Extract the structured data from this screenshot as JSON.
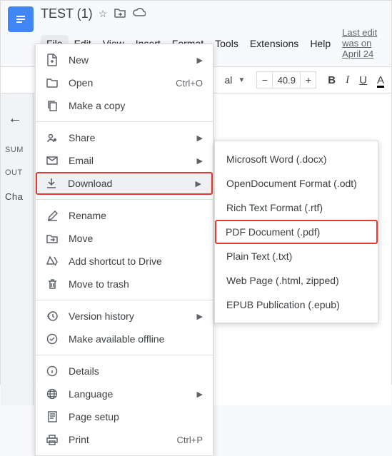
{
  "header": {
    "title": "TEST (1)",
    "edit_info": "Last edit was on April 24",
    "menu": [
      "File",
      "Edit",
      "View",
      "Insert",
      "Format",
      "Tools",
      "Extensions",
      "Help"
    ]
  },
  "toolbar": {
    "zoom": "40.9",
    "bold": "B",
    "italic": "I",
    "underline": "U",
    "text_color": "A"
  },
  "left_panel": {
    "summary": "SUM",
    "outline": "OUT",
    "chapter": "Cha"
  },
  "file_menu": {
    "new": "New",
    "open": "Open",
    "open_shortcut": "Ctrl+O",
    "make_copy": "Make a copy",
    "share": "Share",
    "email": "Email",
    "download": "Download",
    "rename": "Rename",
    "move": "Move",
    "add_shortcut": "Add shortcut to Drive",
    "move_trash": "Move to trash",
    "version_history": "Version history",
    "offline": "Make available offline",
    "details": "Details",
    "language": "Language",
    "page_setup": "Page setup",
    "print": "Print",
    "print_shortcut": "Ctrl+P"
  },
  "download_submenu": {
    "docx": "Microsoft Word (.docx)",
    "odt": "OpenDocument Format (.odt)",
    "rtf": "Rich Text Format (.rtf)",
    "pdf": "PDF Document (.pdf)",
    "txt": "Plain Text (.txt)",
    "html": "Web Page (.html, zipped)",
    "epub": "EPUB Publication (.epub)"
  }
}
